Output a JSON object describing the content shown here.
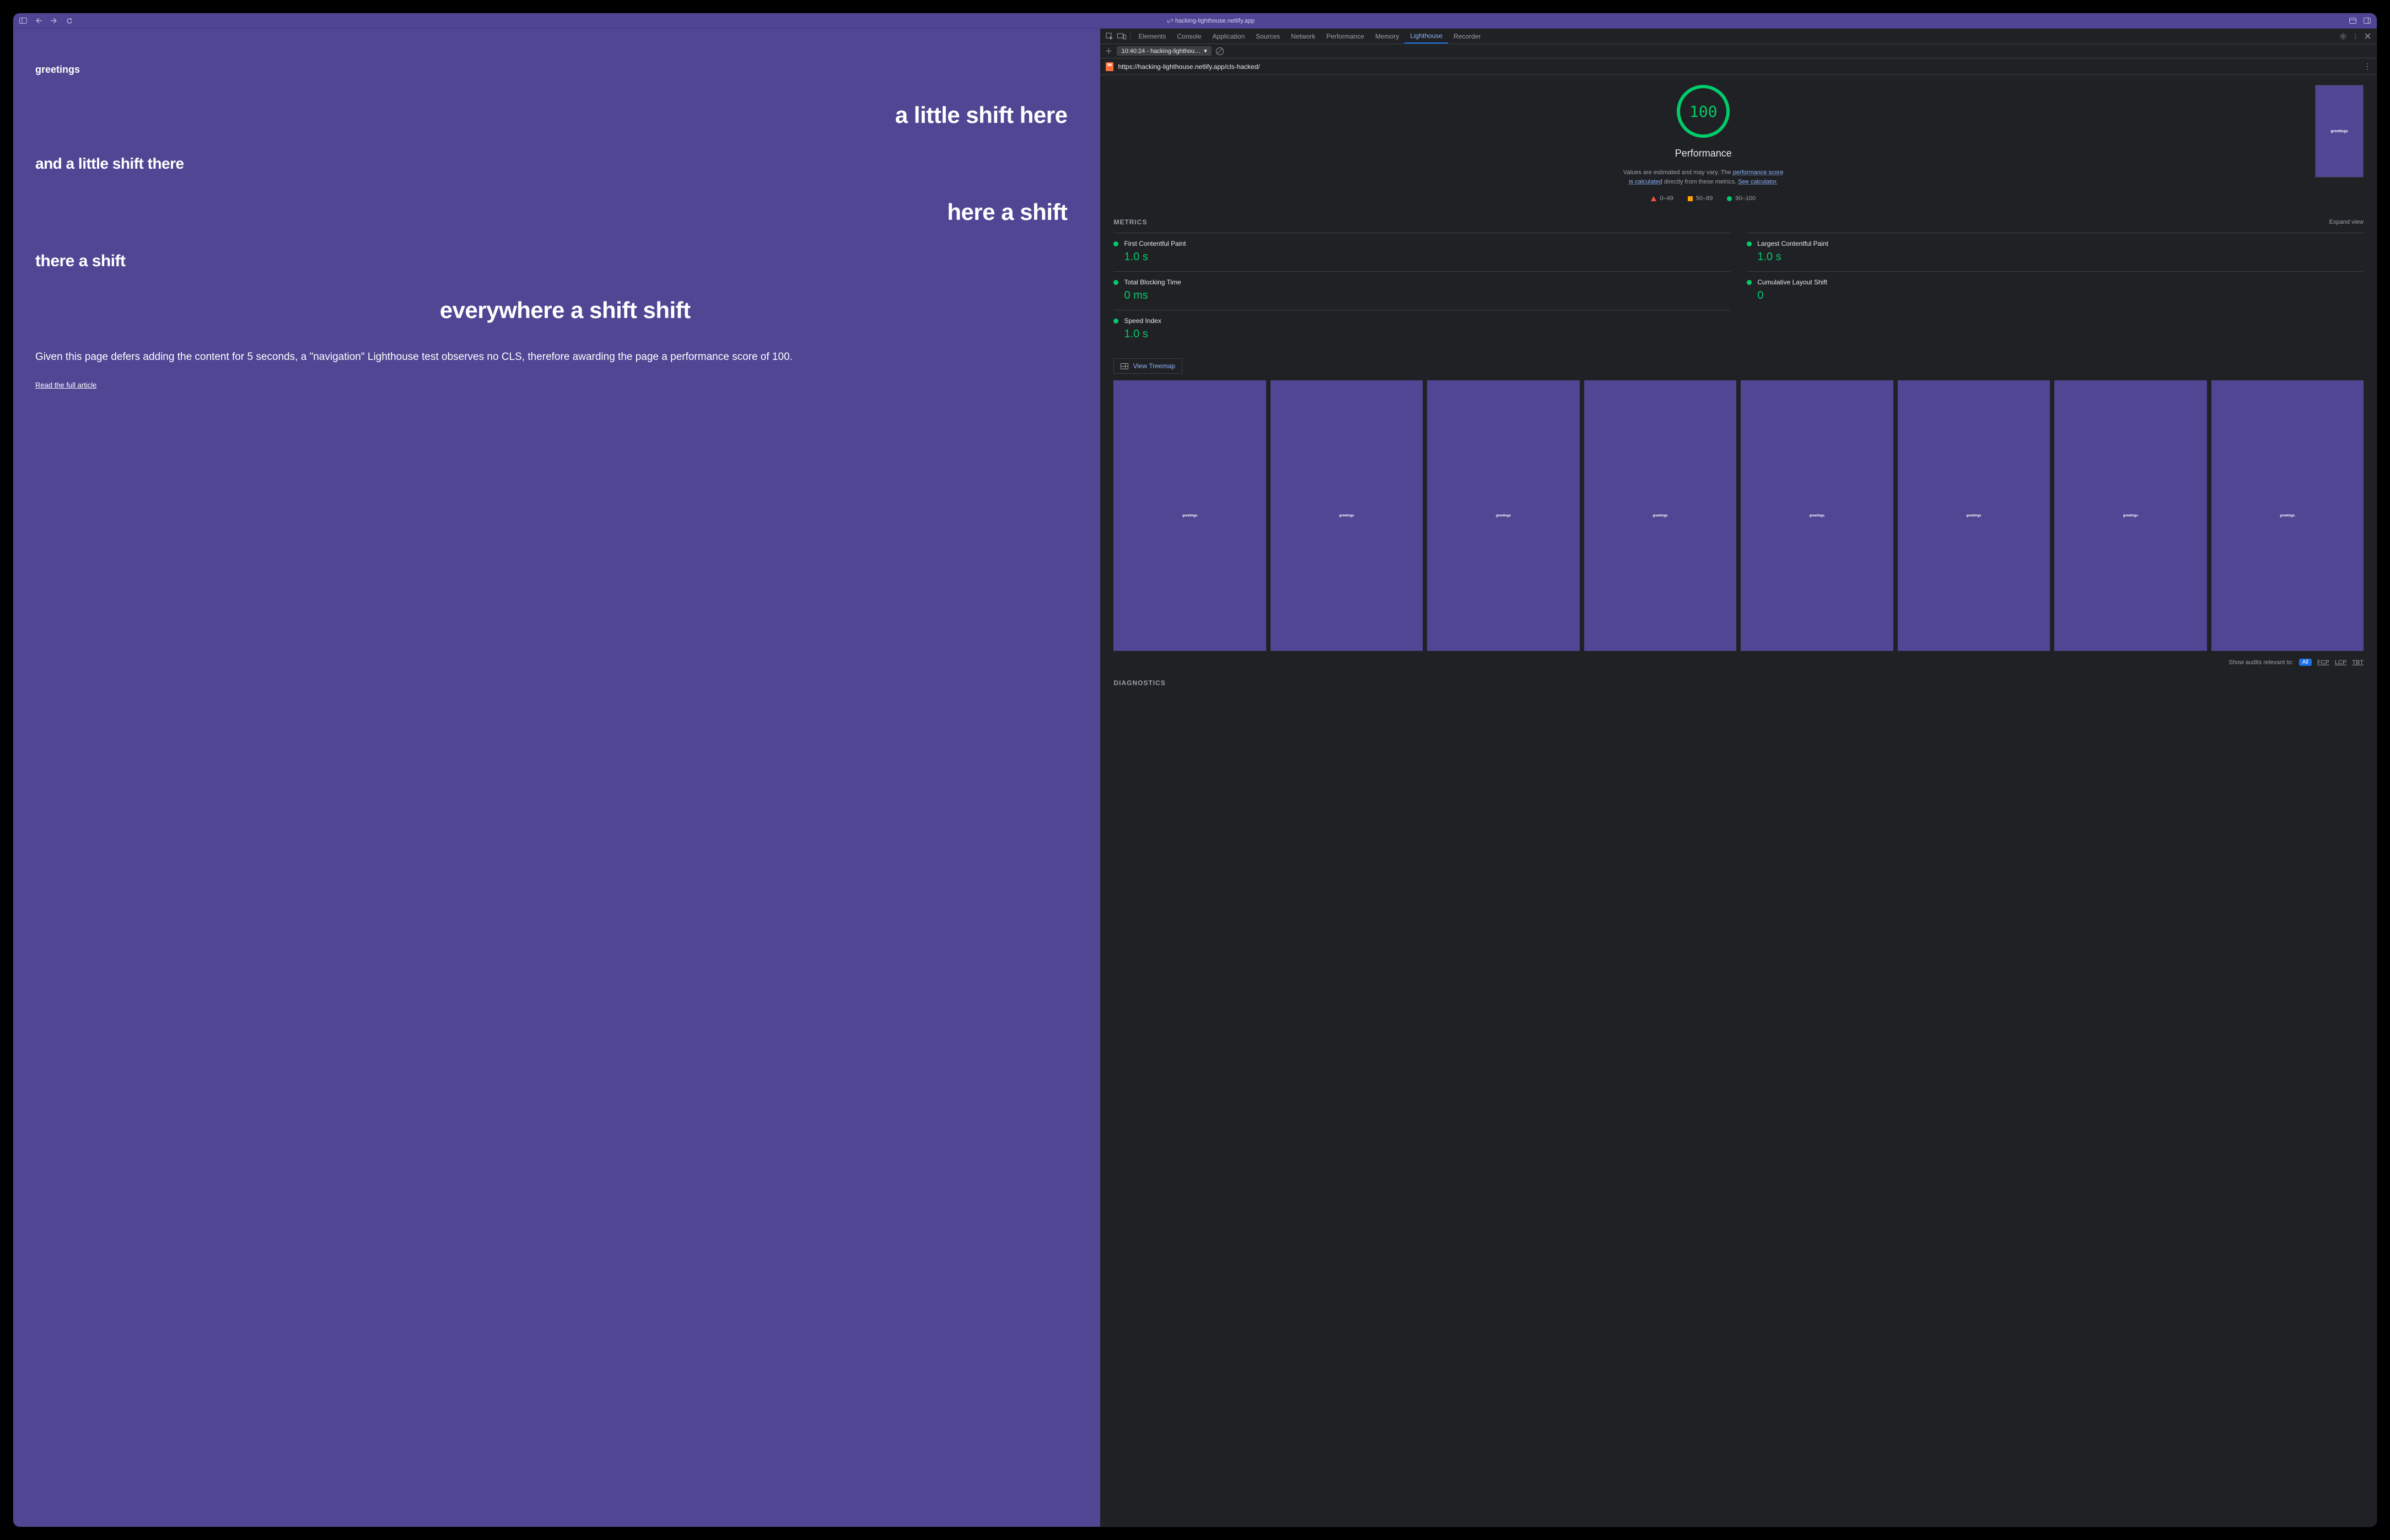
{
  "browser": {
    "url_host": "hacking-lighthouse.netlify.app"
  },
  "page": {
    "lines": {
      "l1": "greetings",
      "l2": "a little shift here",
      "l3": "and a little shift there",
      "l4": "here a shift",
      "l5": "there a shift",
      "l6": "everywhere a shift shift"
    },
    "paragraph": "Given this page defers adding the content for 5 seconds, a \"navigation\" Lighthouse test observes no CLS, therefore awarding the page a performance score of 100.",
    "link": "Read the full article"
  },
  "devtools": {
    "tabs": [
      "Elements",
      "Console",
      "Application",
      "Sources",
      "Network",
      "Performance",
      "Memory",
      "Lighthouse",
      "Recorder"
    ],
    "active_tab": "Lighthouse",
    "run_label": "10:40:24 - hacking-lighthou…",
    "page_url": "https://hacking-lighthouse.netlify.app/cls-hacked/",
    "preview_text": "greetings"
  },
  "lighthouse": {
    "score": "100",
    "category": "Performance",
    "desc_prefix": "Values are estimated and may vary. The ",
    "desc_link1": "performance score is calculated",
    "desc_mid": " directly from these metrics. ",
    "desc_link2": "See calculator.",
    "legend": {
      "bad": "0–49",
      "mid": "50–89",
      "good": "90–100"
    },
    "metrics_header": "METRICS",
    "expand": "Expand view",
    "metrics": [
      {
        "name": "First Contentful Paint",
        "value": "1.0 s"
      },
      {
        "name": "Largest Contentful Paint",
        "value": "1.0 s"
      },
      {
        "name": "Total Blocking Time",
        "value": "0 ms"
      },
      {
        "name": "Cumulative Layout Shift",
        "value": "0"
      },
      {
        "name": "Speed Index",
        "value": "1.0 s"
      }
    ],
    "treemap": "View Treemap",
    "filmstrip_text": "greetings",
    "audits_label": "Show audits relevant to:",
    "audit_all": "All",
    "audit_chips": [
      "FCP",
      "LCP",
      "TBT"
    ],
    "diagnostics": "DIAGNOSTICS"
  }
}
